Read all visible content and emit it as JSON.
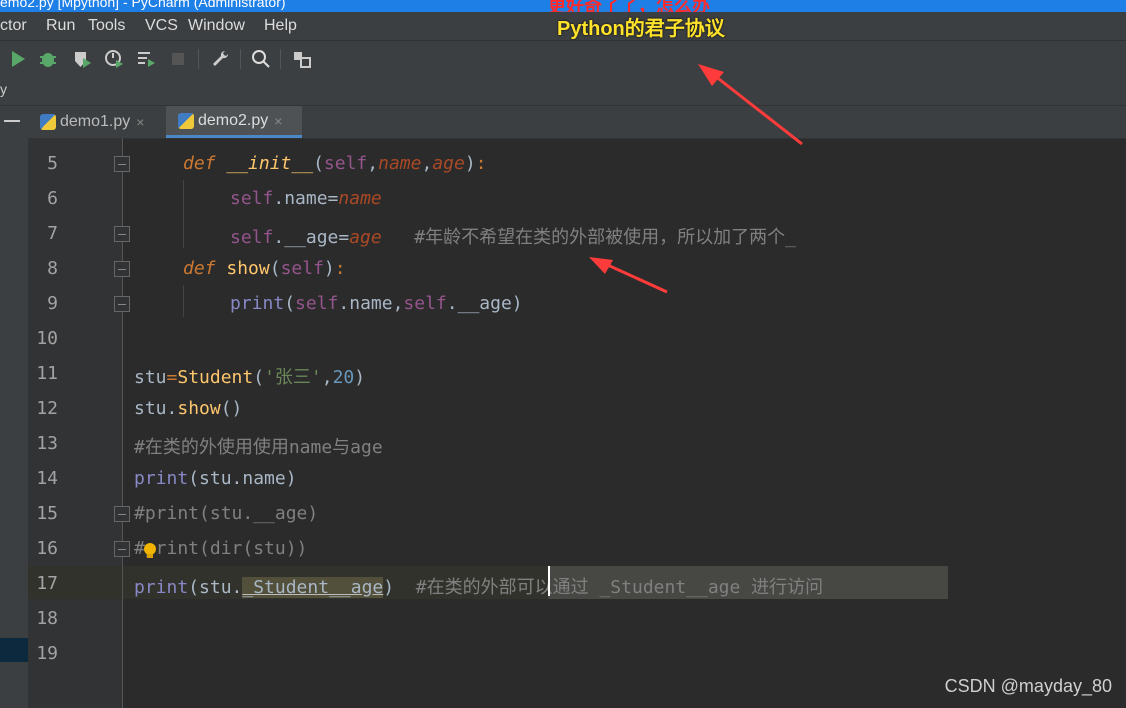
{
  "window": {
    "title": "emo2.py [Mpython] - PyCharm (Administrator)"
  },
  "overlay": {
    "top_red": "更好奇了了，怎么办",
    "top_yellow": "Python的君子协议"
  },
  "menu": [
    "ctor",
    "Run",
    "Tools",
    "VCS",
    "Window",
    "Help"
  ],
  "breadcrumb": "y",
  "tabs": [
    {
      "label": "demo1.py",
      "active": false
    },
    {
      "label": "demo2.py",
      "active": true
    }
  ],
  "lines": [
    {
      "num": "5"
    },
    {
      "num": "6"
    },
    {
      "num": "7"
    },
    {
      "num": "8"
    },
    {
      "num": "9"
    },
    {
      "num": "10"
    },
    {
      "num": "11"
    },
    {
      "num": "12"
    },
    {
      "num": "13"
    },
    {
      "num": "14"
    },
    {
      "num": "15"
    },
    {
      "num": "16"
    },
    {
      "num": "17"
    },
    {
      "num": "18"
    },
    {
      "num": "19"
    }
  ],
  "code": {
    "l5": {
      "kw": "def",
      "name": "__init__",
      "p1": "self",
      "p2": "name",
      "p3": "age"
    },
    "l6": {
      "self": "self",
      "attr": ".name=",
      "val": "name"
    },
    "l7": {
      "self": "self",
      "attr": ".__age=",
      "val": "age",
      "comment": "#年龄不希望在类的外部被使用，所以加了两个_"
    },
    "l8": {
      "kw": "def",
      "name": "show",
      "p1": "self"
    },
    "l9": {
      "fn": "print",
      "a1": "self",
      "a2": ".name,",
      "a3": "self",
      "a4": ".__age)"
    },
    "l11": {
      "pre": "stu",
      "eq": "=",
      "cls": "Student",
      "str": "'张三'",
      "num": "20"
    },
    "l12": {
      "pre": "stu.",
      "fn": "show",
      "post": "()"
    },
    "l13": {
      "comment": "#在类的外使用使用name与age"
    },
    "l14": {
      "fn": "print",
      "post": "(stu.name)"
    },
    "l15": {
      "comment": "#print(stu.__age)"
    },
    "l16": {
      "comment": "#print(dir(stu))"
    },
    "l17": {
      "fn": "print",
      "mid": "(stu.",
      "attr": "_Student__age",
      "close": ")",
      "comment": "#在类的外部可以通过 _Student__age 进行访问"
    }
  },
  "watermark": "CSDN @mayday_80"
}
